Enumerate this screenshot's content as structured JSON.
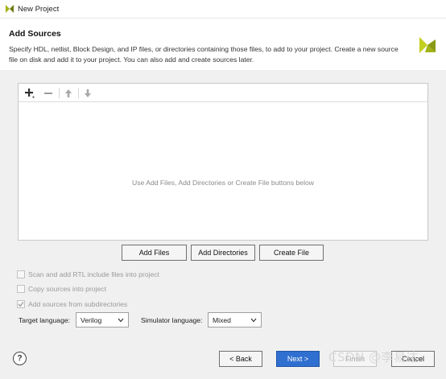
{
  "window": {
    "title": "New Project"
  },
  "header": {
    "title": "Add Sources",
    "description": "Specify HDL, netlist, Block Design, and IP files, or directories containing those files, to add to your project. Create a new source file on disk and add it to your project. You can also add and create sources later."
  },
  "toolbar": {
    "add_icon": "plus-icon",
    "remove_icon": "minus-icon",
    "up_icon": "arrow-up-icon",
    "down_icon": "arrow-down-icon"
  },
  "file_panel": {
    "empty_message": "Use Add Files, Add Directories or Create File buttons below"
  },
  "actions": {
    "add_files": "Add Files",
    "add_directories": "Add Directories",
    "create_file": "Create File"
  },
  "options": [
    {
      "label": "Scan and add RTL include files into project",
      "checked": false,
      "enabled": false
    },
    {
      "label": "Copy sources into project",
      "checked": false,
      "enabled": false
    },
    {
      "label": "Add sources from subdirectories",
      "checked": true,
      "enabled": false
    }
  ],
  "languages": {
    "target_label": "Target language:",
    "target_value": "Verilog",
    "simulator_label": "Simulator language:",
    "simulator_value": "Mixed"
  },
  "footer": {
    "help": "?",
    "back": "< Back",
    "next": "Next >",
    "finish": "Finish",
    "cancel": "Cancel"
  },
  "watermark": "CSDN @李易达",
  "colors": {
    "primary_button": "#2f6fd0",
    "logo_green": "#a3b316",
    "content_bg": "#f0f0f0"
  }
}
